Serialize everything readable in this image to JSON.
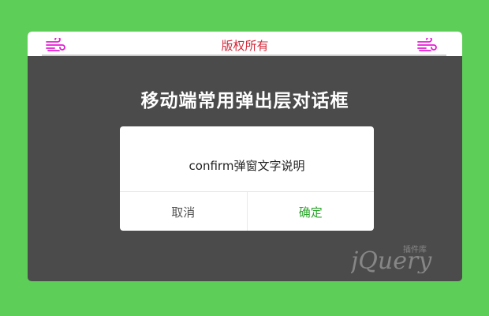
{
  "topbar": {
    "title": "版权所有",
    "left_icon": "wind-icon",
    "right_icon": "wind-icon",
    "accent_color": "#d22a3a",
    "icon_color": "#e61ad6"
  },
  "main": {
    "heading": "移动端常用弹出层对话框"
  },
  "dialog": {
    "message": "confirm弹窗文字说明",
    "cancel_label": "取消",
    "confirm_label": "确定",
    "confirm_color": "#2aa52a"
  },
  "watermark": {
    "text": "jQuery",
    "subtext": "插件库"
  },
  "colors": {
    "page_bg": "#5dcf58",
    "frame_bg": "#4b4b4b"
  }
}
